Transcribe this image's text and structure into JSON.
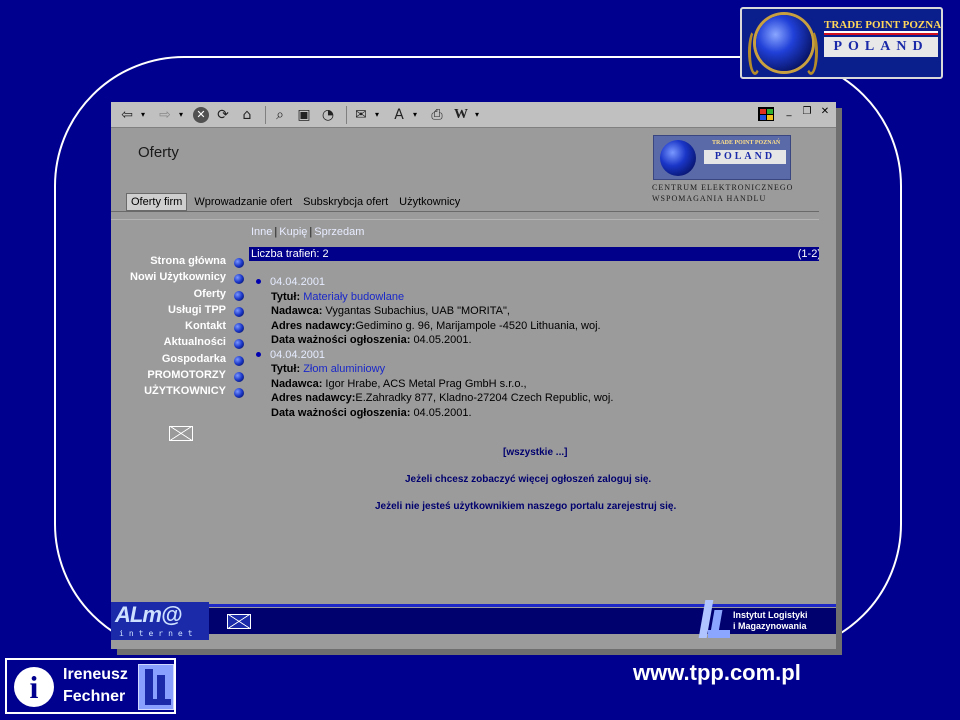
{
  "logo": {
    "line1": "TRADE POINT POZNAŃ",
    "line2": "POLAND"
  },
  "window": {
    "toolbar_icons": [
      "back-icon",
      "forward-icon",
      "stop-icon",
      "refresh-icon",
      "home-icon",
      "search-icon",
      "favorites-icon",
      "history-icon",
      "mail-icon",
      "print-icon",
      "edit-icon",
      "word-icon"
    ],
    "page_title": "Oferty",
    "inner_logo": {
      "line1": "TRADE POINT POZNAŃ",
      "line2": "POLAND"
    },
    "centrum": {
      "line1": "CENTRUM ELEKTRONICZNEGO",
      "line2": "WSPOMAGANIA HANDLU"
    },
    "topnav": [
      "Oferty firm",
      "Wprowadzanie ofert",
      "Subskrybcja ofert",
      "Użytkownicy"
    ],
    "subnav": [
      "Inne",
      "Kupię",
      "Sprzedam"
    ],
    "sidemenu": [
      "Strona główna",
      "Nowi Użytkownicy",
      "Oferty",
      "Usługi TPP",
      "Kontakt",
      "Aktualności",
      "Gospodarka",
      "PROMOTORZY",
      "UŻYTKOWNICY"
    ],
    "results": {
      "label": "Liczba trafień:  2",
      "range": "(1-2)"
    },
    "offers": [
      {
        "date": "04.04.2001",
        "title_label": "Tytuł:",
        "title": "Materiały budowlane",
        "sender_label": "Nadawca:",
        "sender": "Vygantas Subachius, UAB \"MORITA\",",
        "address_label": "Adres nadawcy:",
        "address": "Gedimino g. 96, Marijampole -4520 Lithuania, woj.",
        "valid_label": "Data ważności ogłoszenia:",
        "valid": "04.05.2001."
      },
      {
        "date": "04.04.2001",
        "title_label": "Tytuł:",
        "title": "Złom aluminiowy",
        "sender_label": "Nadawca:",
        "sender": "Igor Hrabe, ACS Metal Prag GmbH s.r.o.,",
        "address_label": "Adres nadawcy:",
        "address": "E.Zahradky 877, Kladno-27204 Czech Republic, woj.",
        "valid_label": "Data ważności ogłoszenia:",
        "valid": "04.05.2001."
      }
    ],
    "all_link": "[wszystkie ...]",
    "note1": "Jeżeli chcesz zobaczyć więcej ogłoszeń zaloguj się.",
    "note2": "Jeżeli nie jesteś użytkownikiem naszego portalu zarejestruj się.",
    "footer": {
      "alm_big": "ALm@",
      "alm_small": "internet",
      "ilim_line1": "Instytut Logistyki",
      "ilim_line2": "i Magazynowania"
    }
  },
  "author": {
    "first": "Ireneusz",
    "last": "Fechner",
    "info_glyph": "i"
  },
  "url": "www.tpp.com.pl"
}
